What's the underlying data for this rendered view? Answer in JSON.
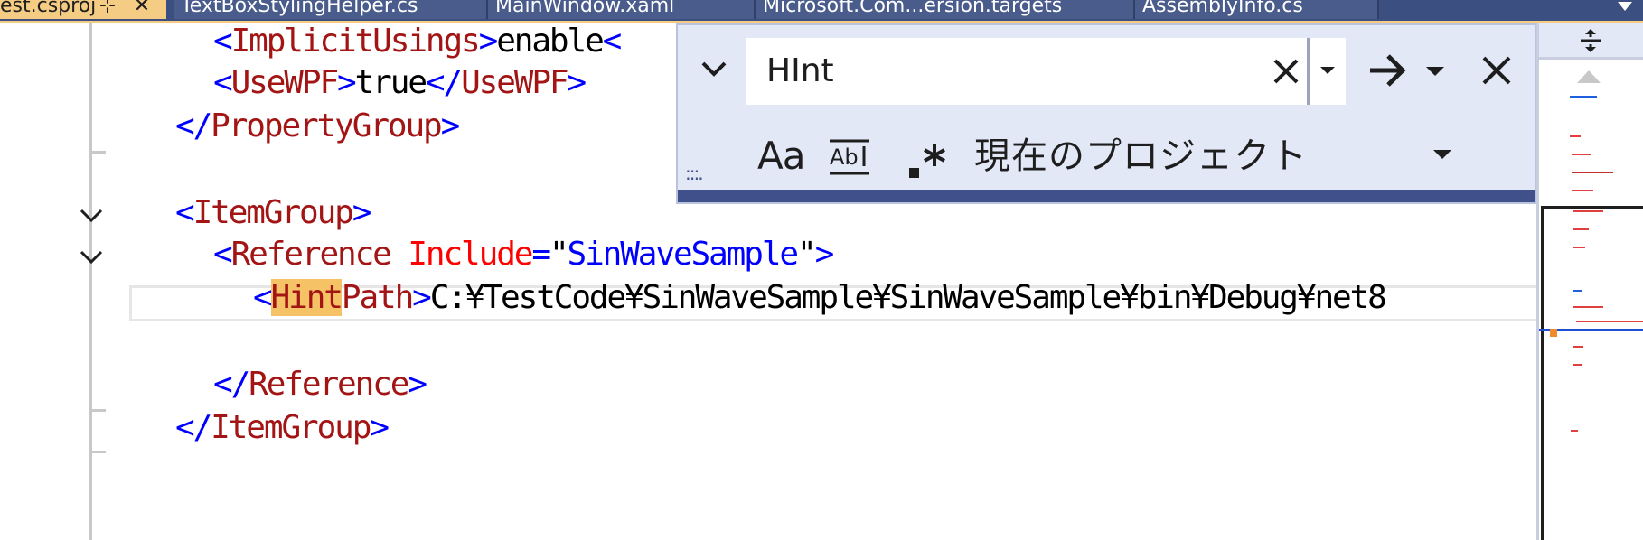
{
  "tabs": [
    {
      "label": "est.csproj",
      "active": true,
      "pin_icon": "pin-icon",
      "close_icon": "close-icon"
    },
    {
      "label": "TextBoxStylingHelper.cs",
      "active": false
    },
    {
      "label": "MainWindow.xaml",
      "active": false
    },
    {
      "label": "Microsoft.Com...ersion.targets",
      "active": false
    },
    {
      "label": "AssemblyInfo.cs",
      "active": false
    }
  ],
  "editor": {
    "lines": {
      "implicit_open": "<",
      "implicit_tag": "ImplicitUsings",
      "implicit_gt": ">",
      "implicit_value": "enable",
      "implicit_lt": "<",
      "usewpf_open": "<",
      "usewpf_tag": "UseWPF",
      "usewpf_gt": ">",
      "usewpf_value": "true",
      "usewpf_close_open": "</",
      "usewpf_close_tag": "UseWPF",
      "usewpf_close_gt": ">",
      "pg_close_open": "</",
      "pg_close_tag": "PropertyGroup",
      "pg_close_gt": ">",
      "ig_open": "<",
      "ig_tag": "ItemGroup",
      "ig_gt": ">",
      "ref_open": "<",
      "ref_tag": "Reference",
      "ref_attr": "Include",
      "ref_eq": "=",
      "ref_q1": "\"",
      "ref_value": "SinWaveSample",
      "ref_q2": "\"",
      "ref_gt": ">",
      "hp_open": "<",
      "hp_tag_match": "Hint",
      "hp_tag_rest": "Path",
      "hp_gt": ">",
      "hp_value": "C:¥TestCode¥SinWaveSample¥SinWaveSample¥bin¥Debug¥net8",
      "ref_close_open": "</",
      "ref_close_tag": "Reference",
      "ref_close_gt": ">",
      "ig_close_open": "</",
      "ig_close_tag": "ItemGroup",
      "ig_close_gt": ">"
    }
  },
  "find": {
    "query": "HInt",
    "scope": "現在のプロジェクト",
    "match_case_label": "Aa",
    "grip": ":::.",
    "icons": {
      "expand": "chevron-down-icon",
      "clear": "close-icon",
      "history": "dropdown-icon",
      "next": "arrow-right-icon",
      "whole_word": "whole-word-icon",
      "regex": "regex-icon",
      "close": "close-icon"
    }
  },
  "colors": {
    "tab_strip": "#3b4f81",
    "active_tab": "#f5cc84",
    "find_background": "#e3e8f7",
    "find_bar": "#40508a",
    "tag_bracket": "#0000ff",
    "tag_name": "#a31515",
    "attribute": "#ff0000",
    "attribute_value": "#0000ff",
    "match_highlight": "#f5c266"
  }
}
